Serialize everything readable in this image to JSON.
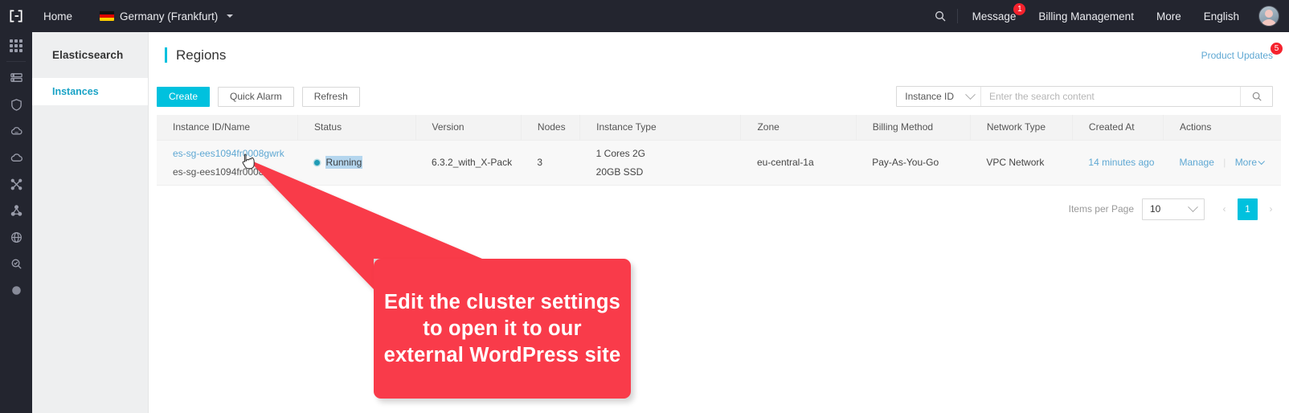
{
  "topbar": {
    "logo_icon": "cloud-console-logo-icon",
    "home_label": "Home",
    "region": {
      "label": "Germany (Frankfurt)",
      "flag_icon": "germany-flag-icon",
      "caret_icon": "caret-down-icon"
    },
    "search_icon": "search-icon",
    "message_label": "Message",
    "message_badge": "1",
    "billing_label": "Billing Management",
    "more_label": "More",
    "language_label": "English",
    "avatar_icon": "user-avatar-icon"
  },
  "rail": {
    "items": [
      {
        "name": "apps-grid-icon"
      },
      {
        "name": "server-stack-icon"
      },
      {
        "name": "shield-icon"
      },
      {
        "name": "cloud-database-icon"
      },
      {
        "name": "cloud-icon"
      },
      {
        "name": "network-cross-icon"
      },
      {
        "name": "nodes-share-icon"
      },
      {
        "name": "globe-icon"
      },
      {
        "name": "security-scan-icon"
      },
      {
        "name": "sphere-dot-icon"
      }
    ]
  },
  "sidebar": {
    "title": "Elasticsearch",
    "items": [
      {
        "label": "Instances",
        "active": true
      }
    ]
  },
  "page": {
    "title": "Regions",
    "product_updates_label": "Product Updates",
    "product_updates_badge": "5"
  },
  "toolbar": {
    "create_label": "Create",
    "quick_alarm_label": "Quick Alarm",
    "refresh_label": "Refresh"
  },
  "search": {
    "filter_label": "Instance ID",
    "filter_caret_icon": "chevron-down-icon",
    "placeholder": "Enter the search content",
    "value": "",
    "submit_icon": "search-icon"
  },
  "table": {
    "columns": [
      "Instance ID/Name",
      "Status",
      "Version",
      "Nodes",
      "Instance Type",
      "Zone",
      "Billing Method",
      "Network Type",
      "Created At",
      "Actions"
    ],
    "rows": [
      {
        "instance_id": "es-sg-ees1094fr0008gwrk",
        "instance_name": "es-sg-ees1094fr0008u...",
        "status": "Running",
        "status_dot_color": "#1e9bb5",
        "version": "6.3.2_with_X-Pack",
        "nodes": "3",
        "instance_type_cores": "1 Cores 2G",
        "instance_type_disk": "20GB SSD",
        "zone": "eu-central-1a",
        "billing_method": "Pay-As-You-Go",
        "network_type": "VPC Network",
        "created_at": "14 minutes ago",
        "action_manage": "Manage",
        "action_more": "More"
      }
    ]
  },
  "pagination": {
    "items_per_page_label": "Items per Page",
    "items_per_page_value": "10",
    "prev_label": "‹",
    "next_label": "›",
    "current_page": "1"
  },
  "callout": {
    "text": "Edit the cluster settings to open it to our external WordPress site",
    "color": "#f93b4a"
  },
  "colors": {
    "accent": "#00c1de",
    "link": "#5fa8d3",
    "topbar_bg": "#23252f",
    "badge_red": "#f5222d"
  }
}
